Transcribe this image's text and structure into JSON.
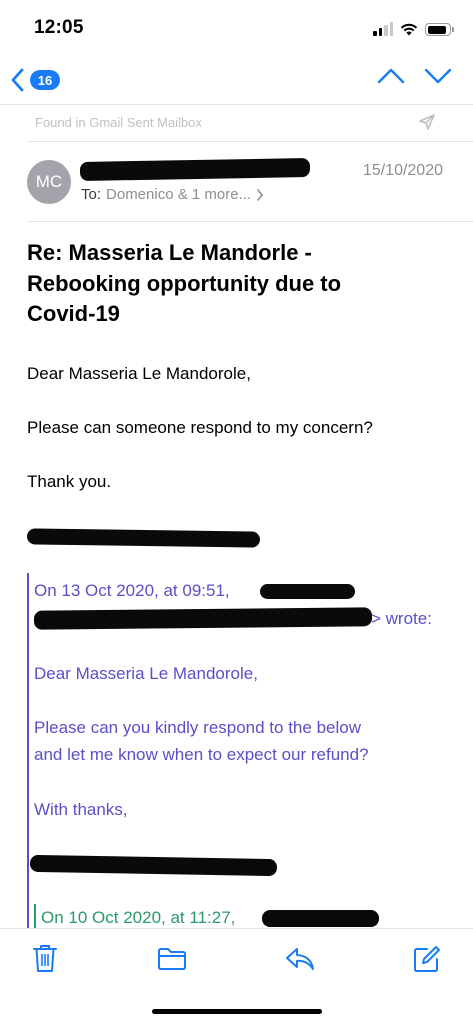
{
  "status_bar": {
    "time": "12:05",
    "battery_level": 0.85,
    "signal_bars_active": 2,
    "signal_bars_total": 4
  },
  "nav": {
    "unread_count": "16",
    "accent_color": "#1a7cf5"
  },
  "found_in": "Found in Gmail Sent Mailbox",
  "message": {
    "avatar_initials": "MC",
    "date": "15/10/2020",
    "to_label": "To:",
    "to_recipients": "Domenico & 1 more...",
    "subject_lines": [
      "Re: Masseria Le Mandorle -",
      "Rebooking opportunity due to",
      "Covid-19"
    ],
    "body": {
      "greeting": "Dear Masseria Le Mandorole,",
      "question": "Please can someone respond to my concern?",
      "thanks": "Thank you."
    }
  },
  "quote1": {
    "header": "On 13 Oct 2020, at 09:51,",
    "wrote": "> wrote:",
    "greeting": "Dear Masseria Le Mandorole,",
    "line1": "Please can you kindly respond to the below",
    "line2": "and let me know when to expect our refund?",
    "signoff": "With thanks,",
    "color": "#5a4fc7"
  },
  "quote2": {
    "header": "On 10 Oct 2020, at 11:27,",
    "color": "#2b9a6a"
  },
  "toolbar": {
    "icons": [
      "trash-icon",
      "folder-icon",
      "reply-icon",
      "compose-icon"
    ]
  }
}
